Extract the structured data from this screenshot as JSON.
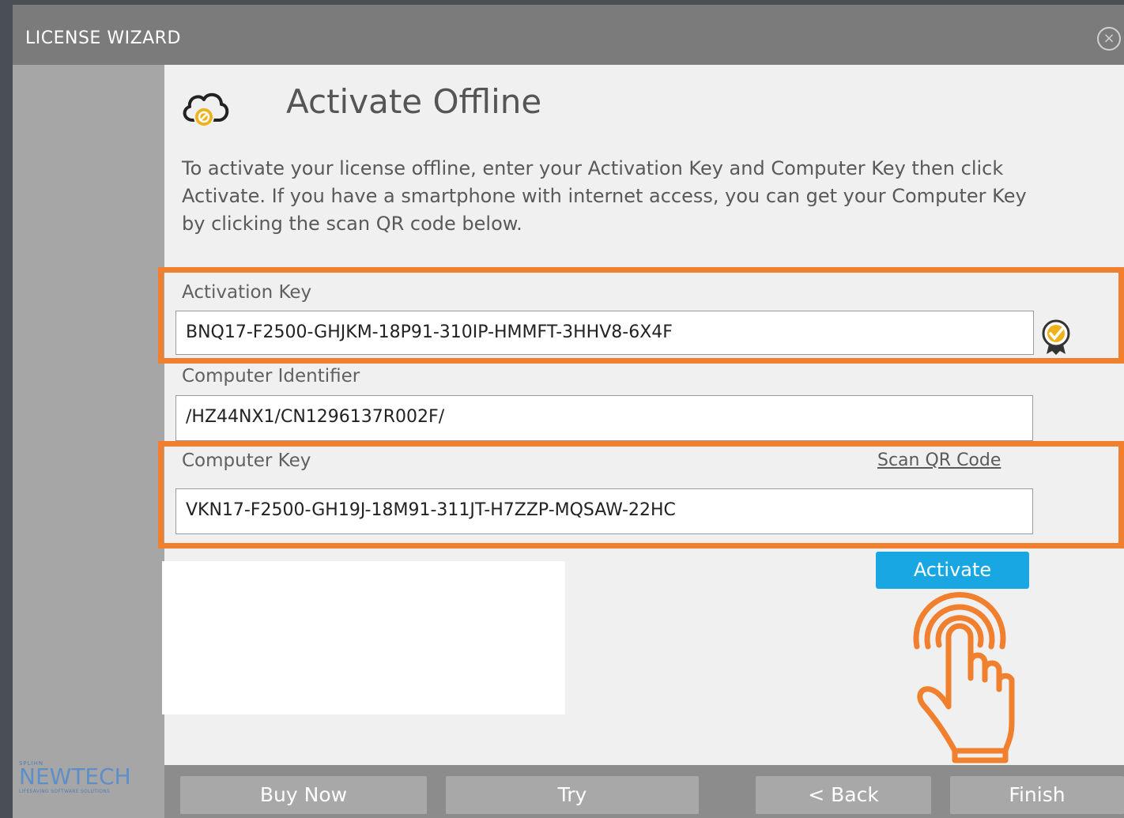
{
  "window": {
    "title": "LICENSE WIZARD",
    "close_symbol": "×"
  },
  "header": {
    "icon": "cloud-blocked-icon",
    "title": "Activate Offline"
  },
  "description": "To activate your license offline, enter your Activation Key and Computer Key then click Activate. If you have a smartphone with internet access, you can get your Computer Key by clicking the scan QR code below.",
  "fields": {
    "activation_key": {
      "label": "Activation Key",
      "value": "BNQ17-F2500-GHJKM-18P91-310IP-HMMFT-3HHV8-6X4F"
    },
    "computer_identifier": {
      "label": "Computer Identifier",
      "value": "/HZ44NX1/CN1296137R002F/"
    },
    "computer_key": {
      "label": "Computer Key",
      "value": "VKN17-F2500-GH19J-18M91-311JT-H7ZZP-MQSAW-22HC",
      "scan_link": "Scan QR Code"
    }
  },
  "activate_button": "Activate",
  "brand": {
    "small": "SPLIHN",
    "name": "NEWTECH",
    "tagline": "LIFESAVING SOFTWARE SOLUTIONS"
  },
  "footer": {
    "buy_now": "Buy Now",
    "try": "Try",
    "back": "< Back",
    "finish": "Finish"
  },
  "colors": {
    "highlight": "#f07f2e",
    "accent": "#18a7e3",
    "titlebar": "#7b7b7b"
  }
}
